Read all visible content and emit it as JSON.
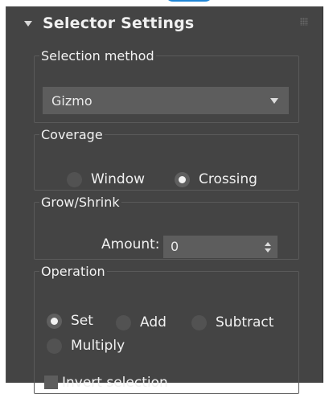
{
  "rollout": {
    "title": "Selector Settings"
  },
  "selection_method": {
    "legend": "Selection method",
    "selected": "Gizmo"
  },
  "coverage": {
    "legend": "Coverage",
    "options": [
      {
        "label": "Window",
        "checked": false
      },
      {
        "label": "Crossing",
        "checked": true
      }
    ]
  },
  "grow_shrink": {
    "legend": "Grow/Shrink",
    "amount_label": "Amount:",
    "amount_value": "0"
  },
  "operation": {
    "legend": "Operation",
    "options": [
      {
        "label": "Set",
        "checked": true
      },
      {
        "label": "Add",
        "checked": false
      },
      {
        "label": "Subtract",
        "checked": false
      },
      {
        "label": "Multiply",
        "checked": false
      }
    ],
    "invert_label": "Invert selection",
    "invert_checked": false
  }
}
